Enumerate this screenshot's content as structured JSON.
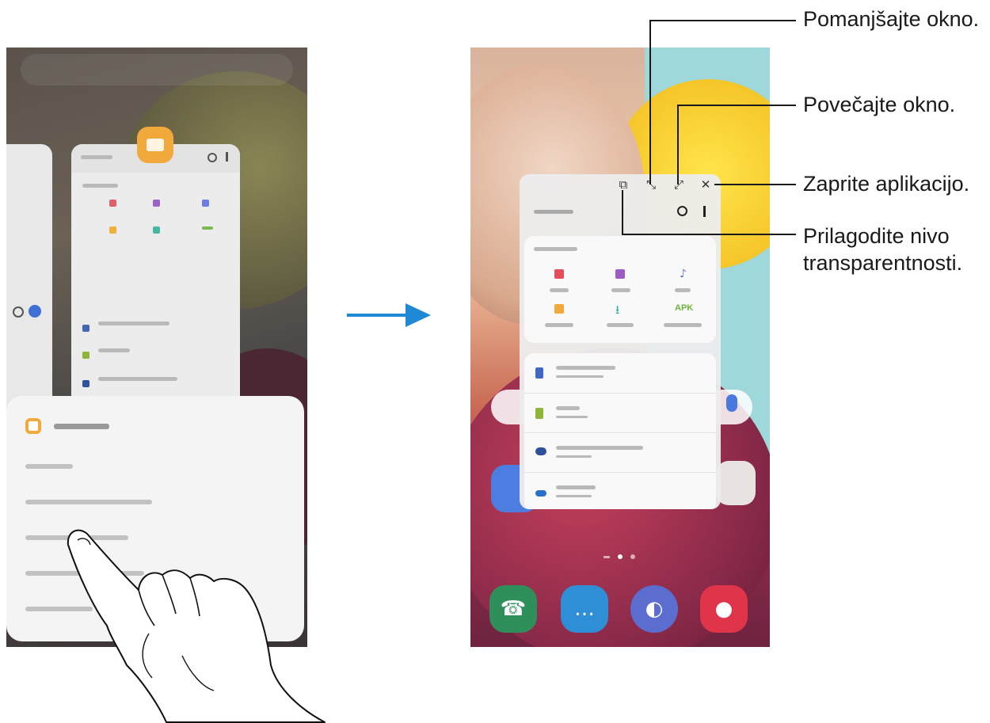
{
  "arrow": {
    "color": "#1e8ad6"
  },
  "callouts": {
    "minimize": "Pomanjšajte okno.",
    "maximize": "Povečajte okno.",
    "close": "Zaprite aplikacijo.",
    "transparency_line1": "Prilagodite nivo",
    "transparency_line2": "transparentnosti."
  },
  "popup_window": {
    "buttons": {
      "transparency": "⧉",
      "minimize": "⤡",
      "maximize": "⤢",
      "close": "✕"
    },
    "apk_label": "APK"
  },
  "colors": {
    "accent_blue": "#1e8ad6",
    "myfiles_orange": "#f2a93b"
  }
}
